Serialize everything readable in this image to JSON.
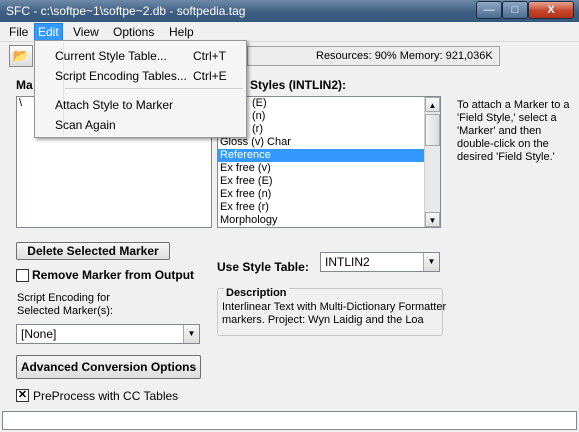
{
  "window": {
    "title": "SFC - c:\\softpe~1\\softpe~2.db - softpedia.tag",
    "minimize_glyph": "—",
    "maximize_glyph": "□",
    "close_glyph": "X"
  },
  "menubar": {
    "items": [
      "File",
      "Edit",
      "View",
      "Options",
      "Help"
    ]
  },
  "edit_menu": {
    "items": [
      {
        "label": "Current Style Table...",
        "shortcut": "Ctrl+T"
      },
      {
        "label": "Script Encoding Tables...",
        "shortcut": "Ctrl+E"
      },
      {
        "label": "Attach Style to Marker",
        "shortcut": ""
      },
      {
        "label": "Scan Again",
        "shortcut": ""
      }
    ]
  },
  "toolbar": {
    "open_icon": "open-folder-icon",
    "open_glyph": "📂"
  },
  "status": {
    "text": "Resources: 90%  Memory: 921,036K"
  },
  "markers": {
    "label_partial": "Ma",
    "items": [
      "\\"
    ]
  },
  "field_styles": {
    "label": "Styles (INTLIN2):",
    "items": [
      "(E)",
      "(n)",
      "(r)",
      "Gloss (v) Char",
      "Reference",
      "Ex free (v)",
      "Ex free (E)",
      "Ex free (n)",
      "Ex free (r)",
      "Morphology"
    ],
    "selected_index": 4
  },
  "help_text": "To attach a Marker to a 'Field Style,' select a 'Marker' and then double-click on the desired 'Field Style.'",
  "buttons": {
    "delete_marker": "Delete Selected Marker",
    "advanced": "Advanced Conversion Options"
  },
  "remove_marker": {
    "label": "Remove Marker from Output",
    "checked": false
  },
  "script_encoding": {
    "label_line1": "Script Encoding for",
    "label_line2": "Selected Marker(s):",
    "value": "[None]"
  },
  "style_table": {
    "label": "Use Style Table:",
    "value": "INTLIN2"
  },
  "description": {
    "title": "Description",
    "text_line1": "Interlinear Text with Multi-Dictionary Formatter",
    "text_line2": "markers. Project: Wyn Laidig and the Loa"
  },
  "preprocess": {
    "label": "PreProcess with CC Tables",
    "checked": true,
    "check_glyph": "✕"
  },
  "arrows": {
    "up": "▲",
    "down": "▼"
  }
}
